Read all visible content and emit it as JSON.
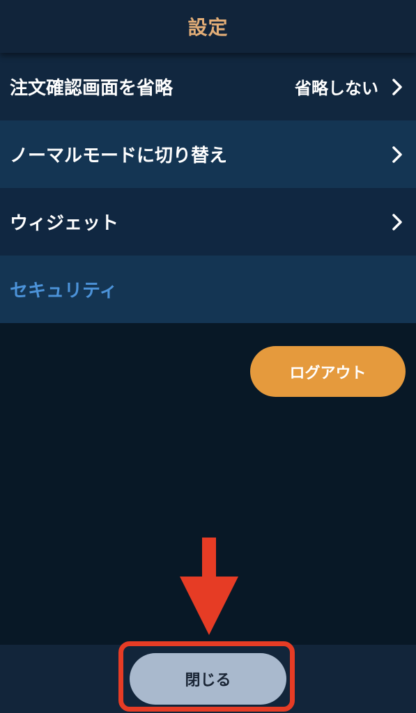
{
  "header": {
    "title": "設定"
  },
  "settings": {
    "items": [
      {
        "label": "注文確認画面を省略",
        "value": "省略しない",
        "icon": "chevron-right-icon"
      },
      {
        "label": "ノーマルモードに切り替え",
        "icon": "chevron-right-icon"
      },
      {
        "label": "ウィジェット",
        "icon": "chevron-right-icon"
      },
      {
        "label": "セキュリティ"
      }
    ]
  },
  "actions": {
    "logout_label": "ログアウト",
    "close_label": "閉じる"
  },
  "annotation": {
    "arrow_icon": "down-arrow-icon",
    "color": "#e63c25"
  },
  "colors": {
    "accent_title": "#e2ad77",
    "logout_button": "#e59a3d",
    "security_link": "#4c93d9",
    "close_button": "#a9b9cd",
    "background": "#081826"
  }
}
